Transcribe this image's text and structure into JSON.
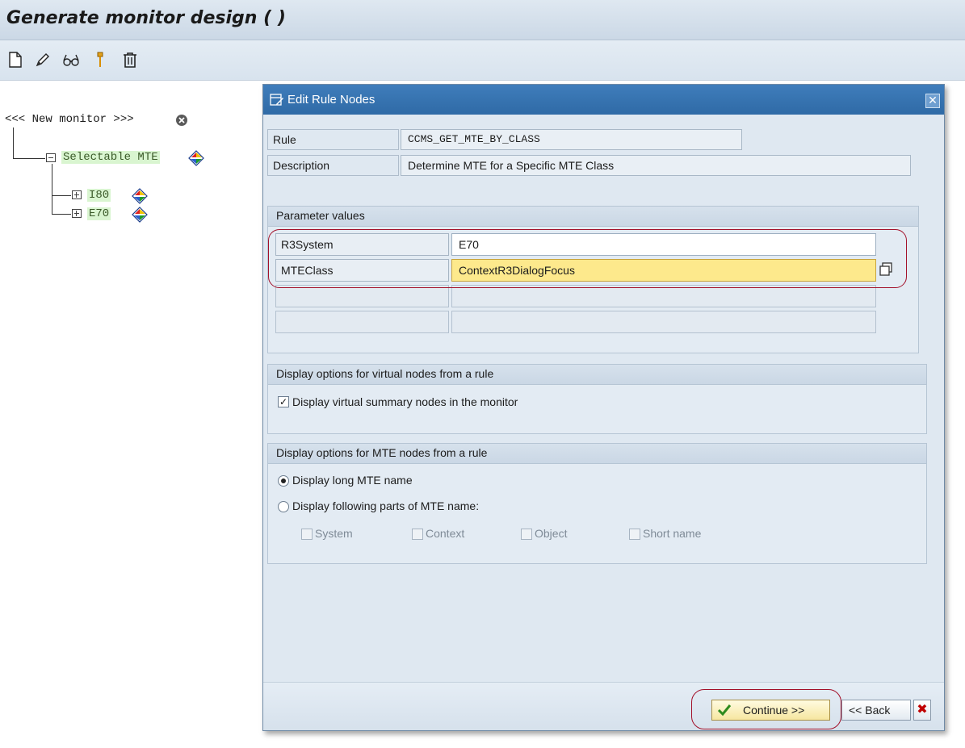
{
  "window": {
    "title": "Generate monitor design ( )"
  },
  "toolbar": {
    "icons": [
      "new-document-icon",
      "edit-pencil-icon",
      "glasses-display-icon",
      "pin-icon",
      "trash-icon"
    ]
  },
  "tree": {
    "root_label": "<<< New monitor >>>",
    "selectable": "Selectable MTE",
    "children": [
      "I80",
      "E70"
    ]
  },
  "dialog": {
    "title": "Edit Rule Nodes",
    "rule_label": "Rule",
    "rule_value": "CCMS_GET_MTE_BY_CLASS",
    "description_label": "Description",
    "description_value": "Determine MTE for a Specific MTE Class",
    "params": {
      "header": "Parameter values",
      "rows": [
        {
          "name": "R3System",
          "value": "E70"
        },
        {
          "name": "MTEClass",
          "value": "ContextR3DialogFocus"
        }
      ]
    },
    "virtual": {
      "header": "Display options for virtual nodes from a rule",
      "checkbox_label": "Display virtual summary nodes in the monitor",
      "checked": true
    },
    "mte": {
      "header": "Display options for MTE nodes from a rule",
      "radio_long": "Display long MTE name",
      "radio_parts": "Display following parts of MTE name:",
      "parts": [
        "System",
        "Context",
        "Object",
        "Short name"
      ]
    },
    "buttons": {
      "continue": "Continue >>",
      "back": "<< Back",
      "cancel_icon": "cancel-x-icon"
    }
  },
  "colors": {
    "dialog_title": "#3f7dbb",
    "focus_field": "#fde98c",
    "highlight_oval": "#a3112a",
    "tree_highlight": "#d9f5d0"
  }
}
